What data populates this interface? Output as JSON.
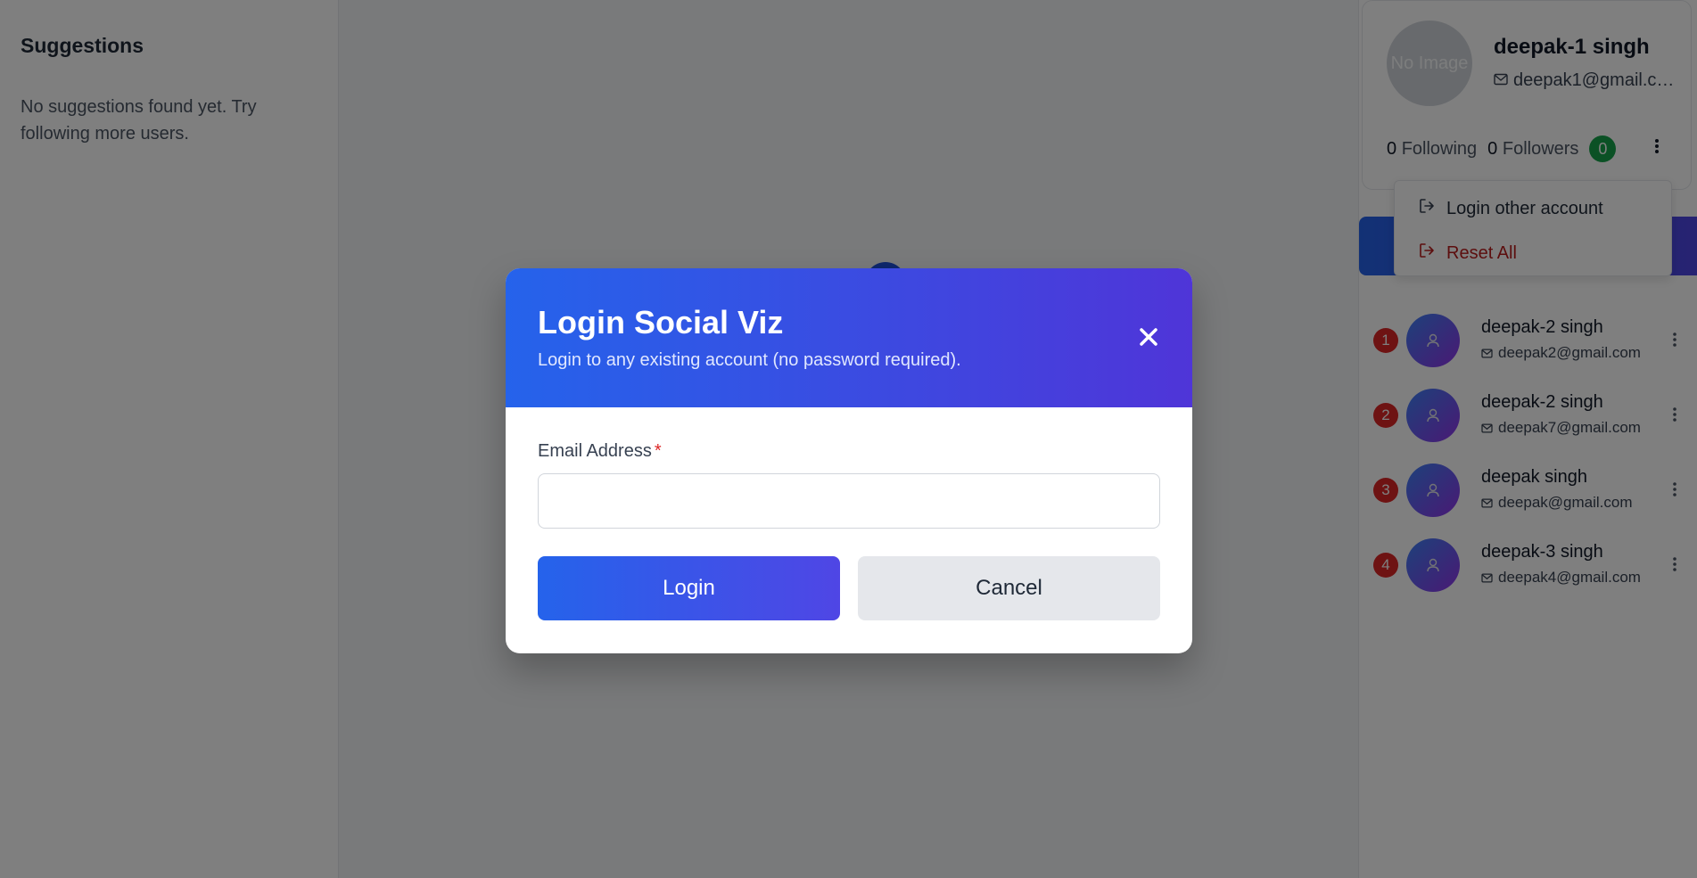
{
  "suggestions": {
    "title": "Suggestions",
    "empty_text": "No suggestions found yet. Try following more users."
  },
  "profile": {
    "avatar_text": "No Image",
    "name": "deepak-1 singh",
    "email": "deepak1@gmail.com",
    "following_count": "0",
    "following_label": "Following",
    "followers_count": "0",
    "followers_label": "Followers",
    "badge": "0"
  },
  "menu": {
    "items": [
      {
        "label": "Login other account",
        "icon": "logout-icon"
      },
      {
        "label": "Reset All",
        "icon": "logout-icon",
        "color": "#b91c1c"
      }
    ]
  },
  "users": [
    {
      "rank": "1",
      "name": "deepak-2 singh",
      "email": "deepak2@gmail.com"
    },
    {
      "rank": "2",
      "name": "deepak-2 singh",
      "email": "deepak7@gmail.com"
    },
    {
      "rank": "3",
      "name": "deepak singh",
      "email": "deepak@gmail.com"
    },
    {
      "rank": "4",
      "name": "deepak-3 singh",
      "email": "deepak4@gmail.com"
    }
  ],
  "modal": {
    "title": "Login Social Viz",
    "subtitle": "Login to any existing account (no password required).",
    "email_label": "Email Address",
    "required_mark": "*",
    "email_value": "",
    "login_label": "Login",
    "cancel_label": "Cancel"
  },
  "colors": {
    "accent_start": "#2563eb",
    "accent_end": "#4f46e5",
    "danger": "#dc2626",
    "success": "#16a34a"
  }
}
